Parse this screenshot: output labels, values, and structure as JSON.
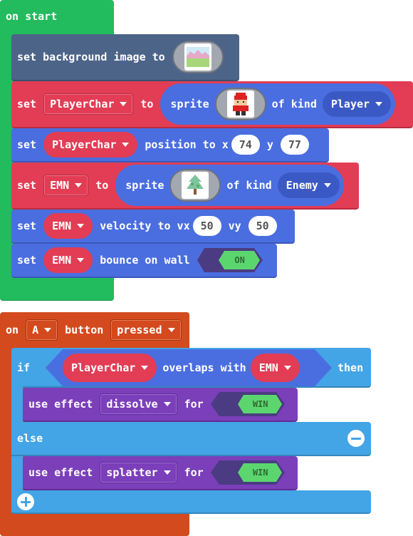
{
  "on_start": {
    "hat_label": "on start",
    "bg_block": {
      "label": "set background image to",
      "image_icon": "background-thumbnail-icon"
    },
    "player_sprite": {
      "set_label": "set",
      "variable": "PlayerChar",
      "to_label": "to",
      "sprite_label": "sprite",
      "image_icon": "player-sprite-thumbnail-icon",
      "of_kind_label": "of kind",
      "kind": "Player"
    },
    "player_position": {
      "set_label": "set",
      "variable": "PlayerChar",
      "label": "position to x",
      "x_value": "74",
      "y_label": "y",
      "y_value": "77"
    },
    "enemy_sprite": {
      "set_label": "set",
      "variable": "EMN",
      "to_label": "to",
      "sprite_label": "sprite",
      "image_icon": "tree-sprite-thumbnail-icon",
      "of_kind_label": "of kind",
      "kind": "Enemy"
    },
    "enemy_velocity": {
      "set_label": "set",
      "variable": "EMN",
      "label": "velocity to vx",
      "vx_value": "50",
      "vy_label": "vy",
      "vy_value": "50"
    },
    "enemy_bounce": {
      "set_label": "set",
      "variable": "EMN",
      "label": "bounce on wall",
      "toggle_state": "ON"
    }
  },
  "on_button": {
    "on_label": "on",
    "button": "A",
    "button_label": "button",
    "event": "pressed",
    "if_block": {
      "if_label": "if",
      "left_variable": "PlayerChar",
      "overlaps_label": "overlaps with",
      "right_variable": "EMN",
      "then_label": "then"
    },
    "effect_1": {
      "label": "use effect",
      "effect": "dissolve",
      "for_label": "for",
      "value": "WIN"
    },
    "else_label": "else",
    "effect_2": {
      "label": "use effect",
      "effect": "splatter",
      "for_label": "for",
      "value": "WIN"
    }
  },
  "colors": {
    "events_green": "#22bb5d",
    "scene_slate": "#4c6488",
    "sprites_blue": "#4a6ee0",
    "variables_red": "#e23d55",
    "controller_orange": "#d34a1e",
    "logic_lightblue": "#43a4e6",
    "effects_purple": "#7b3fba",
    "toggle_green": "#5bd66e",
    "toggle_dark": "#4b3b82"
  }
}
